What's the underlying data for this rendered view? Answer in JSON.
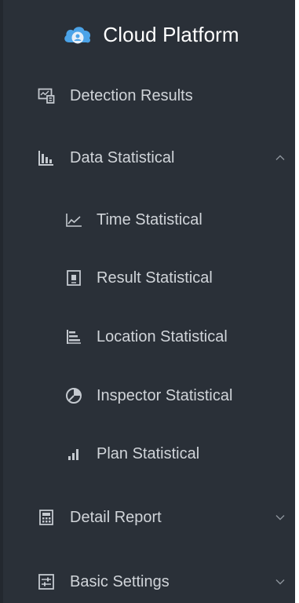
{
  "app": {
    "title": "Cloud Platform",
    "logo_icon": "cloud-icon",
    "accent_color": "#4ba3e8",
    "sidebar_bg": "#2a3038"
  },
  "menu": {
    "items": [
      {
        "label": "Detection Results",
        "icon": "detection-results-icon"
      },
      {
        "label": "Data Statistical",
        "icon": "bar-chart-icon",
        "expanded": true,
        "chevron": "chevron-up-icon",
        "children": [
          {
            "label": "Time Statistical",
            "icon": "line-chart-icon"
          },
          {
            "label": "Result Statistical",
            "icon": "report-card-icon"
          },
          {
            "label": "Location Statistical",
            "icon": "horizontal-bars-icon"
          },
          {
            "label": "Inspector Statistical",
            "icon": "pie-chart-icon"
          },
          {
            "label": "Plan Statistical",
            "icon": "signal-bars-icon"
          }
        ]
      },
      {
        "label": "Detail Report",
        "icon": "calculator-icon",
        "expanded": false,
        "chevron": "chevron-down-icon"
      },
      {
        "label": "Basic Settings",
        "icon": "sliders-icon",
        "expanded": false,
        "chevron": "chevron-down-icon"
      }
    ]
  }
}
